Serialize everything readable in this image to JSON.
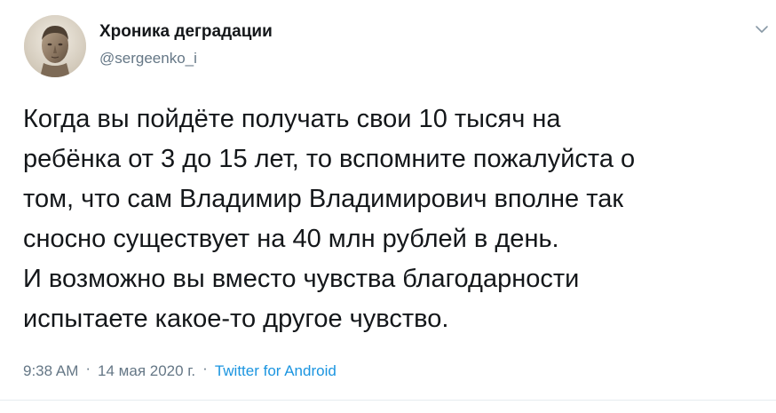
{
  "author": {
    "name": "Хроника деградации",
    "handle": "@sergeenko_i"
  },
  "tweet": {
    "lines": [
      "Когда вы пойдёте получать свои 10 тысяч на",
      "ребёнка от 3 до 15 лет, то вспомните пожалуйста о",
      "том, что сам Владимир Владимирович вполне так",
      "сносно существует на 40 млн рублей в день.",
      "И возможно вы вместо чувства благодарности",
      "испытаете какое-то другое чувство."
    ]
  },
  "meta": {
    "time": "9:38 AM",
    "separator": "·",
    "date": "14 мая 2020 г.",
    "source": "Twitter for Android"
  },
  "icons": {
    "menu_caret": "chevron-down-icon",
    "avatar": "avatar"
  },
  "colors": {
    "text": "#14171a",
    "secondary": "#657786",
    "link": "#1b95e0"
  }
}
